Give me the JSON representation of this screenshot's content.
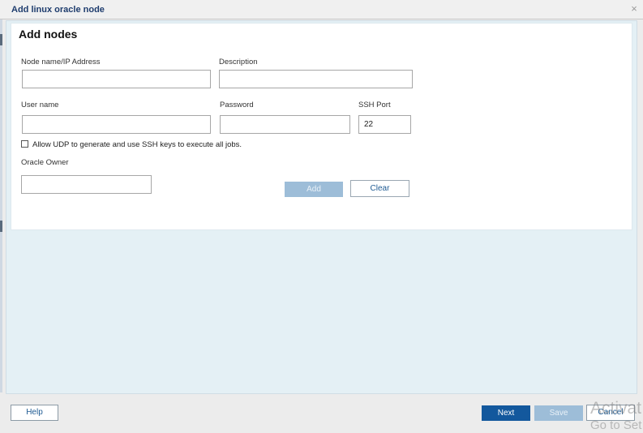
{
  "dialog": {
    "title": "Add linux oracle node",
    "close_glyph": "×"
  },
  "form": {
    "heading": "Add nodes",
    "node_name": {
      "label": "Node name/IP Address",
      "value": ""
    },
    "description": {
      "label": "Description",
      "value": ""
    },
    "user_name": {
      "label": "User name",
      "value": ""
    },
    "password": {
      "label": "Password",
      "value": ""
    },
    "ssh_port": {
      "label": "SSH Port",
      "value": "22"
    },
    "udp_checkbox": {
      "label": "Allow UDP to generate and use SSH keys to execute all jobs.",
      "checked": false
    },
    "oracle_owner": {
      "label": "Oracle Owner",
      "value": ""
    },
    "add_label": "Add",
    "clear_label": "Clear"
  },
  "footer": {
    "help_label": "Help",
    "next_label": "Next",
    "save_label": "Save",
    "cancel_label": "Cancel"
  },
  "watermark": {
    "line1": "Activat",
    "line2": "Go to Set"
  },
  "icons": {
    "close": "close-icon"
  },
  "colors": {
    "title_text": "#1f3d6e",
    "body_background": "#e4f0f5",
    "primary_button": "#13589d",
    "disabled_button": "#9dbdd8",
    "link_text": "#1f5b93"
  }
}
